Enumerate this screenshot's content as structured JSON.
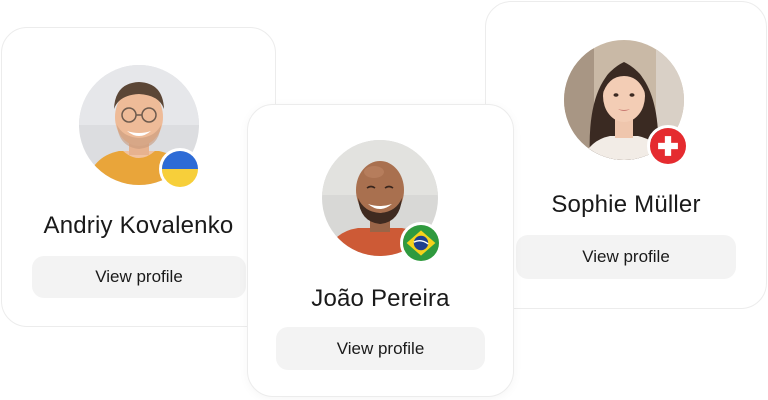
{
  "profiles": [
    {
      "name": "Andriy Kovalenko",
      "button_label": "View profile",
      "flag_icon": "ukraine-flag-icon",
      "flag_colors": [
        "#2d6bd6",
        "#f7cf3a"
      ]
    },
    {
      "name": "João Pereira",
      "button_label": "View profile",
      "flag_icon": "brazil-flag-icon",
      "flag_colors": [
        "#2f9a3e",
        "#f5d21c",
        "#1f3f8f"
      ]
    },
    {
      "name": "Sophie Müller",
      "button_label": "View profile",
      "flag_icon": "switzerland-flag-icon",
      "flag_colors": [
        "#e52b2f",
        "#ffffff"
      ]
    }
  ]
}
